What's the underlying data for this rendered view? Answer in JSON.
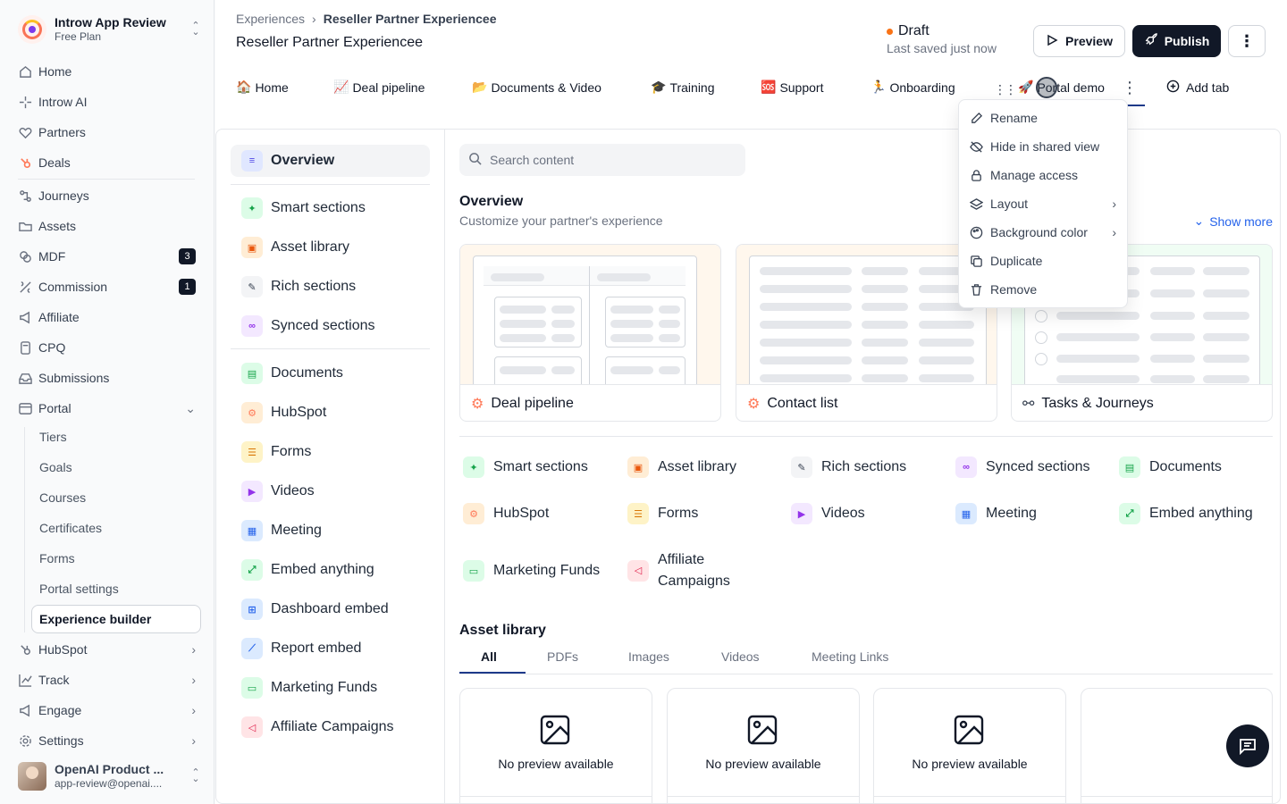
{
  "workspace": {
    "name": "Introw App Review",
    "plan": "Free Plan"
  },
  "nav": {
    "items": [
      {
        "label": "Home",
        "icon": "home-icon"
      },
      {
        "label": "Introw AI",
        "icon": "sparkle-icon"
      },
      {
        "label": "Partners",
        "icon": "partners-icon"
      },
      {
        "label": "Deals",
        "icon": "hubspot-icon"
      },
      {
        "label": "Journeys",
        "icon": "journeys-icon"
      },
      {
        "label": "Assets",
        "icon": "folder-icon"
      },
      {
        "label": "MDF",
        "icon": "coins-icon",
        "badge": "3"
      },
      {
        "label": "Commission",
        "icon": "commission-icon",
        "badge": "1"
      },
      {
        "label": "Affiliate",
        "icon": "megaphone-icon"
      },
      {
        "label": "CPQ",
        "icon": "calculator-icon"
      },
      {
        "label": "Submissions",
        "icon": "inbox-icon"
      },
      {
        "label": "Portal",
        "icon": "portal-icon"
      }
    ],
    "portal_sub": [
      "Tiers",
      "Goals",
      "Courses",
      "Certificates",
      "Forms",
      "Portal settings",
      "Experience builder"
    ],
    "bottom_items": [
      {
        "label": "HubSpot",
        "icon": "hubspot-icon"
      },
      {
        "label": "Track",
        "icon": "chart-icon"
      },
      {
        "label": "Engage",
        "icon": "engage-icon"
      },
      {
        "label": "Settings",
        "icon": "gear-icon"
      }
    ]
  },
  "user": {
    "name": "OpenAI Product ...",
    "email": "app-review@openai...."
  },
  "header": {
    "breadcrumb_root": "Experiences",
    "breadcrumb_current": "Reseller Partner Experiencee",
    "title": "Reseller Partner Experiencee",
    "status": "Draft",
    "saved": "Last saved just now",
    "preview_label": "Preview",
    "publish_label": "Publish"
  },
  "tabs": [
    {
      "emoji": "🏠",
      "label": "Home"
    },
    {
      "emoji": "📈",
      "label": "Deal pipeline"
    },
    {
      "emoji": "📂",
      "label": "Documents & Video"
    },
    {
      "emoji": "🎓",
      "label": "Training"
    },
    {
      "emoji": "🆘",
      "label": "Support"
    },
    {
      "emoji": "🏃",
      "label": "Onboarding"
    },
    {
      "emoji": "🚀",
      "label": "Portal demo"
    }
  ],
  "add_tab_label": "Add tab",
  "context_menu": [
    {
      "label": "Rename",
      "icon": "pencil-icon"
    },
    {
      "label": "Hide in shared view",
      "icon": "eye-off-icon"
    },
    {
      "label": "Manage access",
      "icon": "lock-icon"
    },
    {
      "label": "Layout",
      "icon": "layers-icon",
      "submenu": true
    },
    {
      "label": "Background color",
      "icon": "palette-icon",
      "submenu": true
    },
    {
      "label": "Duplicate",
      "icon": "copy-icon"
    },
    {
      "label": "Remove",
      "icon": "trash-icon"
    }
  ],
  "palette": {
    "overview": "Overview",
    "group1": [
      "Smart sections",
      "Asset library",
      "Rich sections",
      "Synced sections"
    ],
    "group2": [
      "Documents",
      "HubSpot",
      "Forms",
      "Videos",
      "Meeting",
      "Embed anything",
      "Dashboard embed",
      "Report embed",
      "Marketing Funds",
      "Affiliate Campaigns"
    ]
  },
  "canvas": {
    "search_placeholder": "Search content",
    "title": "Overview",
    "subtitle": "Customize your partner's experience",
    "show_more": "Show more",
    "templates": [
      "Deal pipeline",
      "Contact list",
      "Tasks & Journeys"
    ],
    "blocks": [
      "Smart sections",
      "Asset library",
      "Rich sections",
      "Synced sections",
      "Documents",
      "HubSpot",
      "Forms",
      "Videos",
      "Meeting",
      "Embed anything",
      "Marketing Funds",
      "Affiliate Campaigns"
    ],
    "asset_title": "Asset library",
    "asset_tabs": [
      "All",
      "PDFs",
      "Images",
      "Videos",
      "Meeting Links"
    ],
    "no_preview": "No preview available"
  },
  "colors": {
    "accent": "#111827",
    "hubspot": "#ff7a59",
    "link": "#2563eb",
    "status_draft": "#f97316"
  }
}
